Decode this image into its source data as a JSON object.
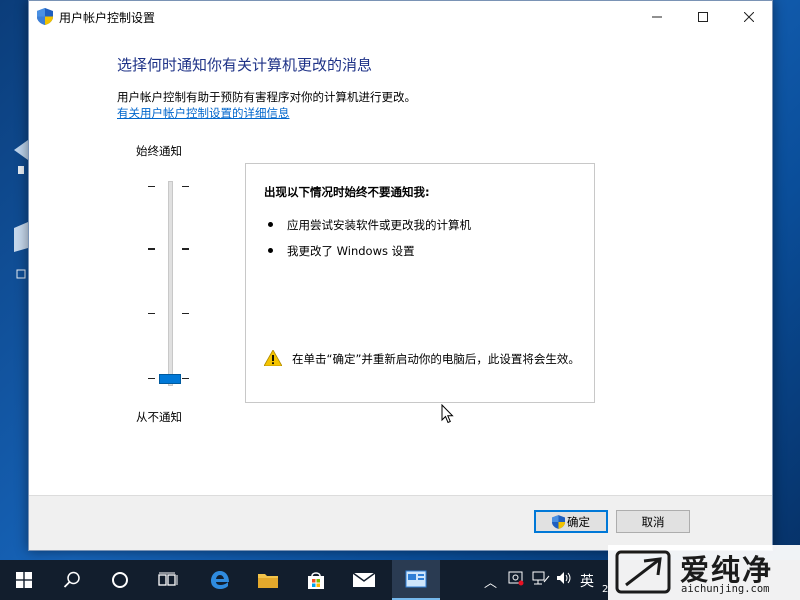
{
  "window": {
    "title": "用户帐户控制设置",
    "controls": {
      "minimize": "—",
      "maximize": "☐",
      "close": "✕"
    }
  },
  "content": {
    "heading": "选择何时通知你有关计算机更改的消息",
    "description": "用户帐户控制有助于预防有害程序对你的计算机进行更改。",
    "more_link": "有关用户帐户控制设置的详细信息"
  },
  "slider": {
    "top_label": "始终通知",
    "bottom_label": "从不通知",
    "levels": 4,
    "selected_level": 1
  },
  "info_box": {
    "title": "出现以下情况时始终不要通知我:",
    "bullets": [
      "应用尝试安装软件或更改我的计算机",
      "我更改了 Windows 设置"
    ],
    "warning": "在单击“确定”并重新启动你的电脑后，此设置将会生效。"
  },
  "footer": {
    "ok_label": "确定",
    "cancel_label": "取消"
  },
  "taskbar": {
    "ime_label": "英",
    "clock_fragment": "2"
  },
  "watermark": {
    "text": "爱纯净",
    "url": "aichunjing.com"
  },
  "colors": {
    "heading": "#1e3287",
    "link": "#0066cc",
    "slider_thumb": "#0078d7",
    "taskbar": "#121e2d"
  }
}
